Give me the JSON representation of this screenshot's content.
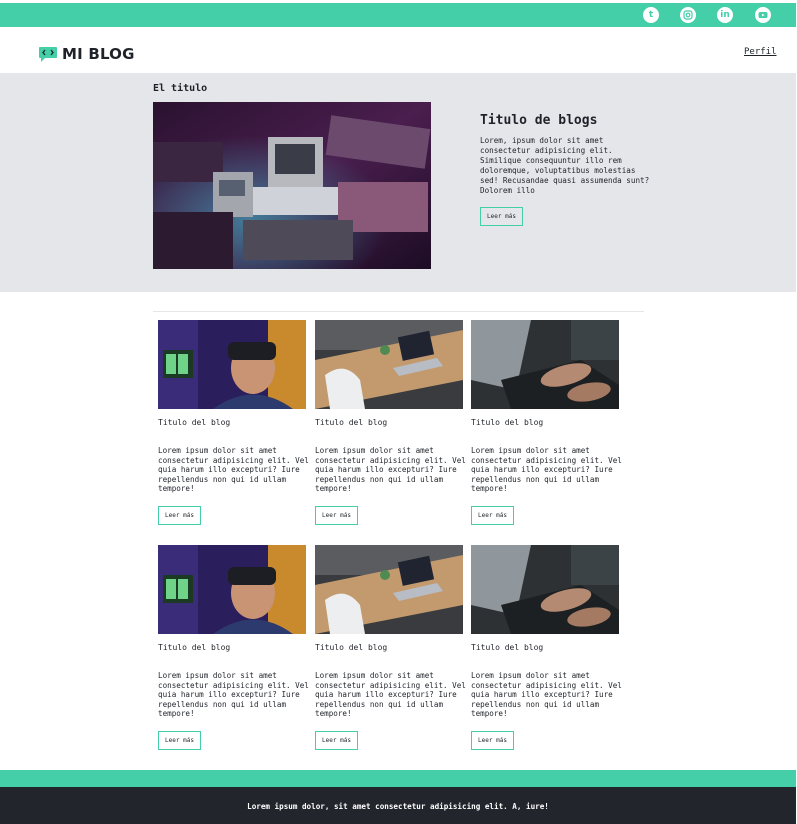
{
  "social": {
    "icons": [
      "tumblr-icon",
      "instagram-icon",
      "linkedin-icon",
      "youtube-icon"
    ],
    "tumblr_glyph": "t",
    "linkedin_glyph": "in"
  },
  "header": {
    "logo_text": "MI BLOG",
    "profile_link": "Perfil"
  },
  "hero": {
    "kicker": "El titulo",
    "title": "Titulo de blogs",
    "text": "Lorem, ipsum dolor sit amet consectetur adipisicing elit. Similique consequuntur illo rem doloremque, voluptatibus molestias sed! Recusandae quasi assumenda sunt? Dolorem illo",
    "button": "Leer más"
  },
  "posts": [
    {
      "title": "Titulo del blog",
      "text": "Lorem ipsum dolor sit amet consectetur adipisicing elit. Vel quia harum illo excepturi? Iure repellendus non qui id ullam tempore!",
      "button": "Leer más"
    },
    {
      "title": "Titulo del blog",
      "text": "Lorem ipsum dolor sit amet consectetur adipisicing elit. Vel quia harum illo excepturi? Iure repellendus non qui id ullam tempore!",
      "button": "Leer más"
    },
    {
      "title": "Titulo del blog",
      "text": "Lorem ipsum dolor sit amet consectetur adipisicing elit. Vel quia harum illo excepturi? Iure repellendus non qui id ullam tempore!",
      "button": "Leer más"
    },
    {
      "title": "Titulo del blog",
      "text": "Lorem ipsum dolor sit amet consectetur adipisicing elit. Vel quia harum illo excepturi? Iure repellendus non qui id ullam tempore!",
      "button": "Leer más"
    },
    {
      "title": "Titulo del blog",
      "text": "Lorem ipsum dolor sit amet consectetur adipisicing elit. Vel quia harum illo excepturi? Iure repellendus non qui id ullam tempore!",
      "button": "Leer más"
    },
    {
      "title": "Titulo del blog",
      "text": "Lorem ipsum dolor sit amet consectetur adipisicing elit. Vel quia harum illo excepturi? Iure repellendus non qui id ullam tempore!",
      "button": "Leer más"
    }
  ],
  "footer": {
    "text": "Lorem ipsum dolor, sit amet consectetur adipisicing elit. A, iure!"
  },
  "colors": {
    "accent": "#44cfa8",
    "hero_background": "#e4e6ea",
    "footer_dark": "#22252b",
    "text": "#1f2329"
  }
}
